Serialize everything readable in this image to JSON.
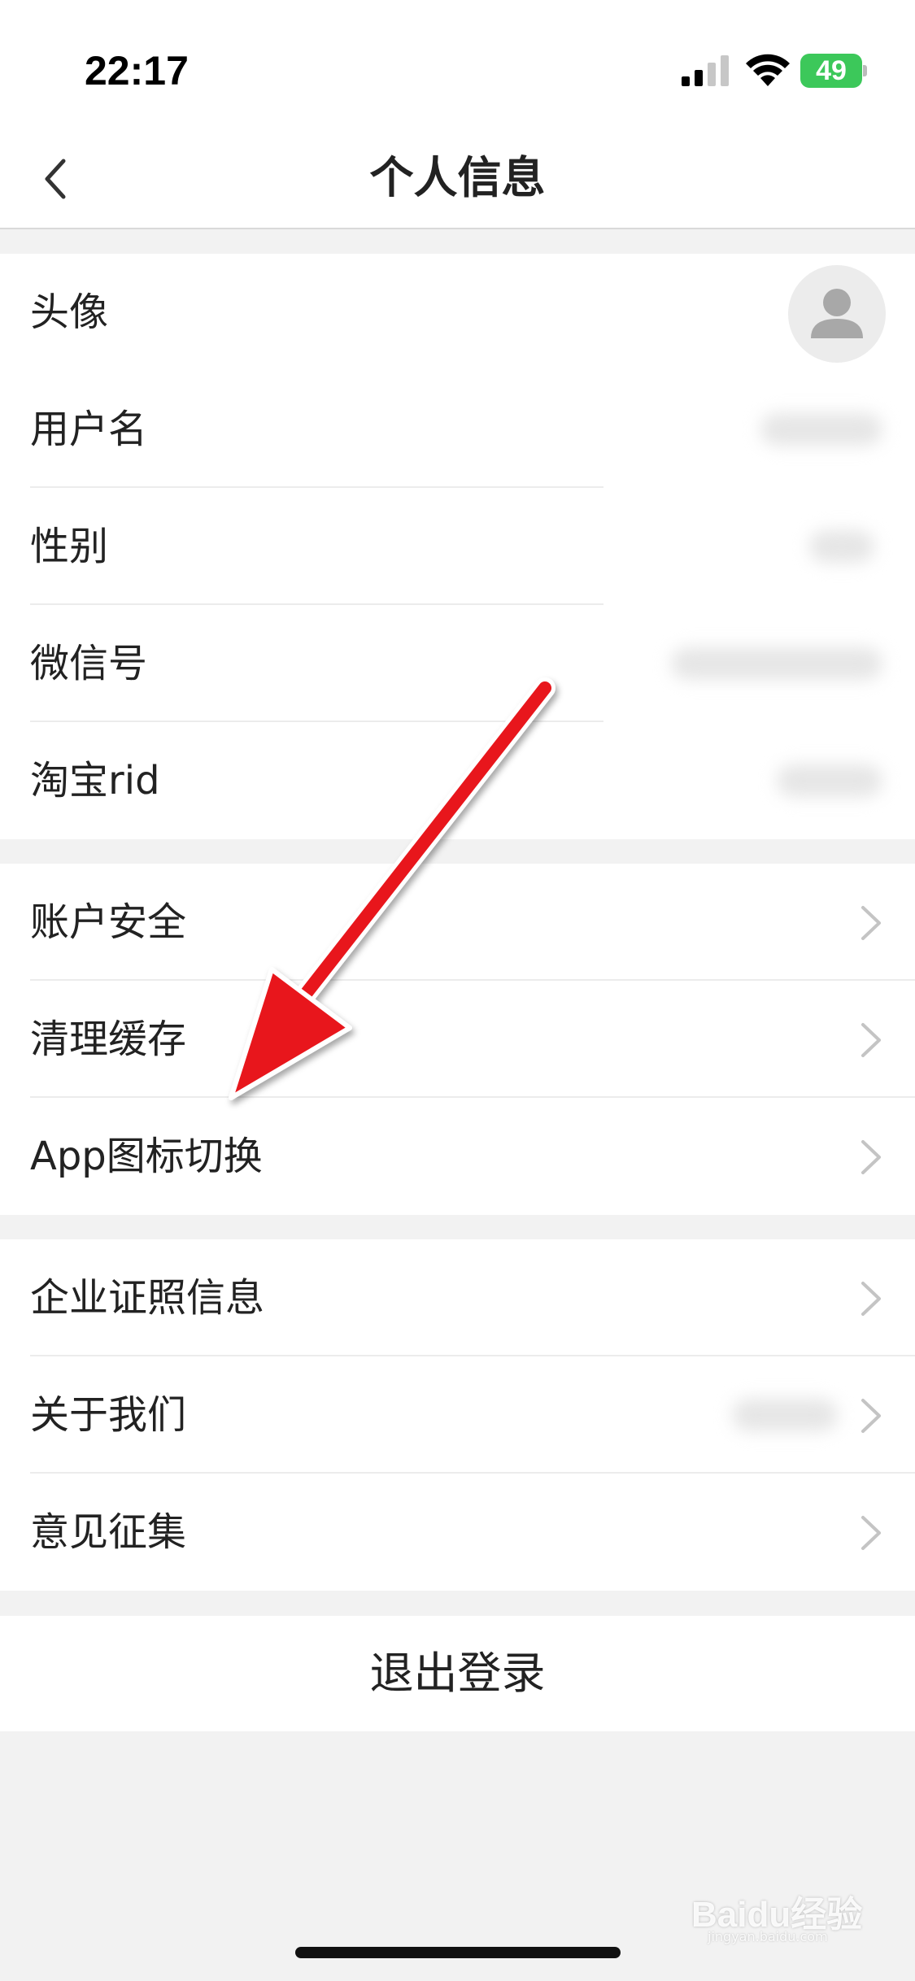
{
  "status_bar": {
    "time": "22:17",
    "battery": "49",
    "signal_icon": "cellular-signal-icon",
    "wifi_icon": "wifi-icon",
    "battery_icon": "battery-charging-icon"
  },
  "nav": {
    "title": "个人信息",
    "back_icon": "chevron-left-icon"
  },
  "profile_group": {
    "rows": [
      {
        "label": "头像",
        "value": "avatar-placeholder"
      },
      {
        "label": "用户名"
      },
      {
        "label": "性别"
      },
      {
        "label": "微信号"
      },
      {
        "label": "淘宝rid"
      }
    ]
  },
  "settings_group": {
    "rows": [
      {
        "label": "账户安全"
      },
      {
        "label": "清理缓存"
      },
      {
        "label": "App图标切换"
      }
    ]
  },
  "info_group": {
    "rows": [
      {
        "label": "企业证照信息"
      },
      {
        "label": "关于我们"
      },
      {
        "label": "意见征集"
      }
    ]
  },
  "logout": {
    "label": "退出登录"
  },
  "annotation": {
    "arrow_color": "#e8141a"
  },
  "watermark": {
    "text": "Baidu经验",
    "sub": "jingyan.baidu.com"
  },
  "colors": {
    "background": "#f2f2f2",
    "surface": "#ffffff",
    "battery": "#3cc85a"
  }
}
